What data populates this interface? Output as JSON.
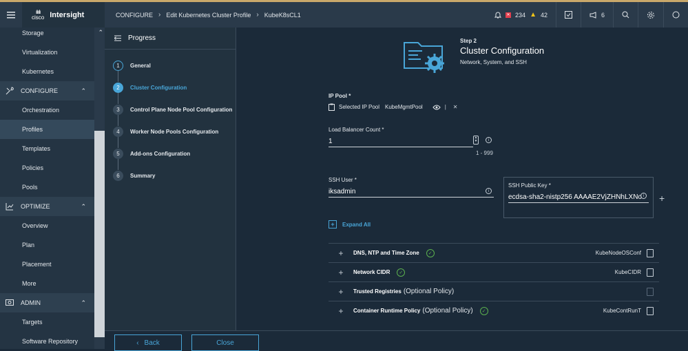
{
  "topbar": {
    "brand_small": "cisco",
    "brand": "Intersight",
    "breadcrumb": [
      "CONFIGURE",
      "Edit Kubernetes Cluster Profile",
      "KubeK8sCL1"
    ],
    "alerts_critical": "234",
    "alerts_warning": "42",
    "announcements": "6"
  },
  "sidebar": {
    "items_top": [
      "Storage",
      "Virtualization",
      "Kubernetes"
    ],
    "configure": {
      "label": "CONFIGURE",
      "items": [
        "Orchestration",
        "Profiles",
        "Templates",
        "Policies",
        "Pools"
      ]
    },
    "optimize": {
      "label": "OPTIMIZE",
      "items": [
        "Overview",
        "Plan",
        "Placement",
        "More"
      ]
    },
    "admin": {
      "label": "ADMIN",
      "items": [
        "Targets",
        "Software Repository"
      ]
    }
  },
  "progress": {
    "title": "Progress",
    "steps": [
      {
        "num": "1",
        "label": "General"
      },
      {
        "num": "2",
        "label": "Cluster Configuration"
      },
      {
        "num": "3",
        "label": "Control Plane Node Pool Configuration"
      },
      {
        "num": "4",
        "label": "Worker Node Pools Configuration"
      },
      {
        "num": "5",
        "label": "Add-ons Configuration"
      },
      {
        "num": "6",
        "label": "Summary"
      }
    ]
  },
  "main": {
    "step_label": "Step 2",
    "step_title": "Cluster Configuration",
    "step_subtitle": "Network, System, and SSH",
    "ip_pool_label": "IP Pool *",
    "selected_ip_pool_label": "Selected IP Pool",
    "selected_ip_pool_value": "KubeMgmtPool",
    "lb_count_label": "Load Balancer Count *",
    "lb_count_value": "1",
    "lb_count_range": "1 - 999",
    "ssh_user_label": "SSH User *",
    "ssh_user_value": "iksadmin",
    "ssh_key_label": "SSH Public Key *",
    "ssh_key_value": "ecdsa-sha2-nistp256 AAAAE2VjZHNhLXNo",
    "expand_all": "Expand All",
    "policies": [
      {
        "name": "DNS, NTP and Time Zone",
        "optional": "",
        "value": "KubeNodeOSConf"
      },
      {
        "name": "Network CIDR",
        "optional": "",
        "value": "KubeCIDR"
      },
      {
        "name": "Trusted Registries",
        "optional": "(Optional Policy)",
        "value": ""
      },
      {
        "name": "Container Runtime Policy",
        "optional": "(Optional Policy)",
        "value": "KubeContRunT"
      }
    ]
  },
  "footer": {
    "back": "Back",
    "close": "Close"
  },
  "colors": {
    "accent": "#49a6d8",
    "success": "#5bb04e",
    "critical": "#e2404f",
    "warning": "#f0c419"
  }
}
